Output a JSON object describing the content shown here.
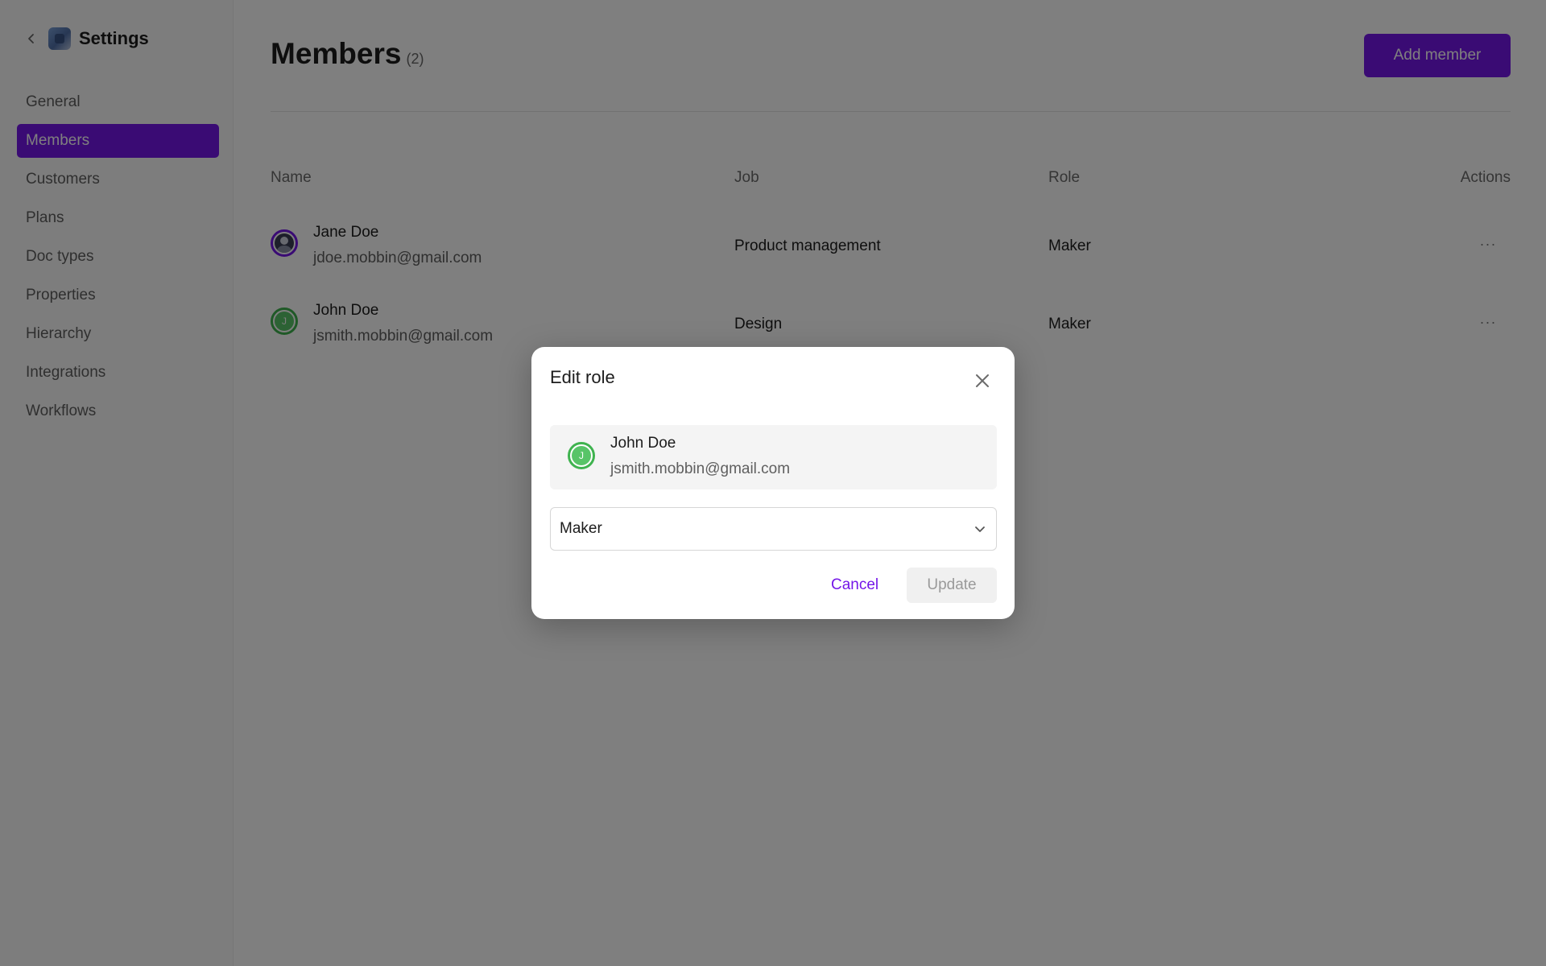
{
  "sidebar": {
    "title": "Settings",
    "items": [
      {
        "label": "General"
      },
      {
        "label": "Members"
      },
      {
        "label": "Customers"
      },
      {
        "label": "Plans"
      },
      {
        "label": "Doc types"
      },
      {
        "label": "Properties"
      },
      {
        "label": "Hierarchy"
      },
      {
        "label": "Integrations"
      },
      {
        "label": "Workflows"
      }
    ],
    "active_item": "Members"
  },
  "main": {
    "title": "Members",
    "count": "(2)",
    "add_button": "Add member",
    "columns": {
      "name": "Name",
      "job": "Job",
      "role": "Role",
      "actions": "Actions"
    },
    "rows": [
      {
        "name": "Jane Doe",
        "email": "jdoe.mobbin@gmail.com",
        "job": "Product management",
        "role": "Maker",
        "actions": "···",
        "avatar": "photo"
      },
      {
        "name": "John Doe",
        "email": "jsmith.mobbin@gmail.com",
        "job": "Design",
        "role": "Maker",
        "actions": "···",
        "avatar_initial": "J"
      }
    ]
  },
  "modal": {
    "title": "Edit role",
    "member": {
      "name": "John Doe",
      "email": "jsmith.mobbin@gmail.com",
      "avatar_initial": "J"
    },
    "role_value": "Maker",
    "cancel_label": "Cancel",
    "update_label": "Update"
  },
  "colors": {
    "accent": "#7416e8",
    "avatar_green": "#58c468",
    "overlay": "rgba(0,0,0,0.5)"
  }
}
